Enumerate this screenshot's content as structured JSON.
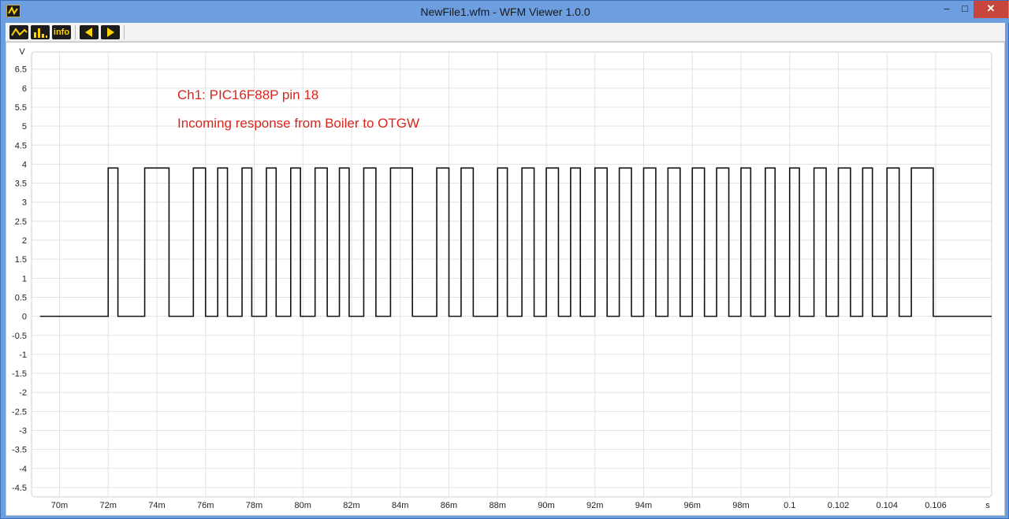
{
  "window": {
    "title": "NewFile1.wfm - WFM Viewer 1.0.0",
    "controls": {
      "minimize": "–",
      "maximize": "□",
      "close": "✕"
    }
  },
  "toolbar": {
    "buttons": [
      {
        "name": "waveform-icon",
        "label": ""
      },
      {
        "name": "histogram-icon",
        "label": ""
      },
      {
        "name": "info-button",
        "label": "info"
      },
      {
        "name": "previous-icon",
        "label": ""
      },
      {
        "name": "next-icon",
        "label": ""
      }
    ]
  },
  "plot": {
    "y_unit": "V",
    "x_unit": "s",
    "annotations": [
      "Ch1: PIC16F88P pin 18",
      "Incoming response from Boiler to OTGW"
    ]
  },
  "chart_data": {
    "type": "line",
    "xlabel": "s",
    "ylabel": "V",
    "x_ticks": [
      "70m",
      "72m",
      "74m",
      "76m",
      "78m",
      "80m",
      "82m",
      "84m",
      "86m",
      "88m",
      "90m",
      "92m",
      "94m",
      "96m",
      "98m",
      "0.1",
      "0.102",
      "0.104",
      "0.106"
    ],
    "y_ticks": [
      "6.5",
      "6",
      "5.5",
      "5",
      "4.5",
      "4",
      "3.5",
      "3",
      "2.5",
      "2",
      "1.5",
      "1",
      "0.5",
      "0",
      "-0.5",
      "-1",
      "-1.5",
      "-2",
      "-2.5",
      "-3",
      "-3.5",
      "-4",
      "-4.5"
    ],
    "xlim": [
      0.06885,
      0.1083
    ],
    "ylim": [
      -4.75,
      6.95
    ],
    "high_level": 3.9,
    "low_level": 0.0,
    "high_pulses": [
      [
        0.072,
        0.0724
      ],
      [
        0.0735,
        0.0745
      ],
      [
        0.0755,
        0.076
      ],
      [
        0.0765,
        0.0769
      ],
      [
        0.0775,
        0.0779
      ],
      [
        0.0785,
        0.0789
      ],
      [
        0.0795,
        0.0799
      ],
      [
        0.0805,
        0.081
      ],
      [
        0.0815,
        0.0819
      ],
      [
        0.0825,
        0.083
      ],
      [
        0.0836,
        0.0845
      ],
      [
        0.0855,
        0.086
      ],
      [
        0.0865,
        0.087
      ],
      [
        0.088,
        0.0884
      ],
      [
        0.089,
        0.0895
      ],
      [
        0.09,
        0.0905
      ],
      [
        0.091,
        0.0914
      ],
      [
        0.092,
        0.0925
      ],
      [
        0.093,
        0.0935
      ],
      [
        0.094,
        0.0945
      ],
      [
        0.095,
        0.0955
      ],
      [
        0.096,
        0.0965
      ],
      [
        0.097,
        0.0975
      ],
      [
        0.098,
        0.0984
      ],
      [
        0.099,
        0.0994
      ],
      [
        0.1,
        0.1004
      ],
      [
        0.101,
        0.1015
      ],
      [
        0.102,
        0.1025
      ],
      [
        0.103,
        0.1034
      ],
      [
        0.104,
        0.1045
      ],
      [
        0.105,
        0.1059
      ]
    ],
    "grid": true
  }
}
